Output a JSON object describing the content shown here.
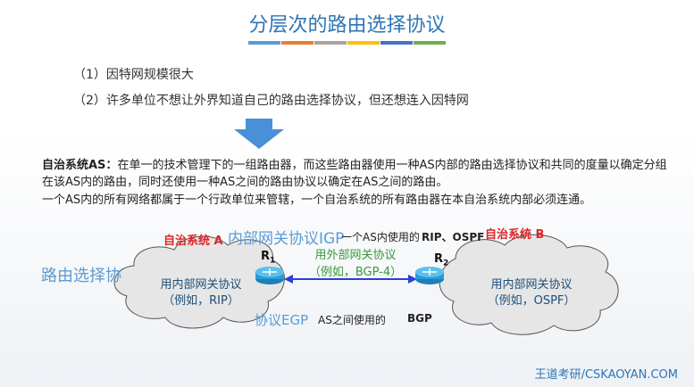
{
  "title": "分层次的路由选择协议",
  "title_bar_colors": [
    "#5b9bd5",
    "#ed7d31",
    "#a5a5a5",
    "#ffc000",
    "#4472c4",
    "#70ad47"
  ],
  "reasons": [
    "（1）因特网规模很大",
    "（2）许多单位不想让外界知道自己的路由选择协议，但还想连入因特网"
  ],
  "definition": {
    "term": "自治系统AS：",
    "text": "在单一的技术管理下的一组路由器，而这些路由器使用一种AS内部的路由选择协议和共同的度量以确定分组在该AS内的路由，同时还使用一种AS之间的路由协议以确定在AS之间的路由。",
    "note": "一个AS内的所有网络都属于一个行政单位来管辖，一个自治系统的所有路由器在本自治系统内部必须连通。"
  },
  "igp": {
    "label": "内部网关协议IGP",
    "desc": "一个AS内使用的",
    "examples": "RIP、OSPF"
  },
  "egp": {
    "label": "外部网关协议EGP",
    "label_visible": "协议EGP",
    "desc": "AS之间使用的",
    "examples": "BGP"
  },
  "heading_partial": "路由选择协",
  "as_a": {
    "label": "自治系统 A",
    "inner": "用内部网关协议",
    "example": "（例如，RIP）",
    "router": "R",
    "router_sub": "1"
  },
  "as_b": {
    "label": "自治系统 B",
    "inner": "用内部网关协议",
    "example": "（例如，OSPF）",
    "router": "R",
    "router_sub": "2"
  },
  "external": {
    "line1": "用外部网关协议",
    "line2": "（例如，BGP-4）"
  },
  "footer": "王道考研/CSKAOYAN.COM"
}
